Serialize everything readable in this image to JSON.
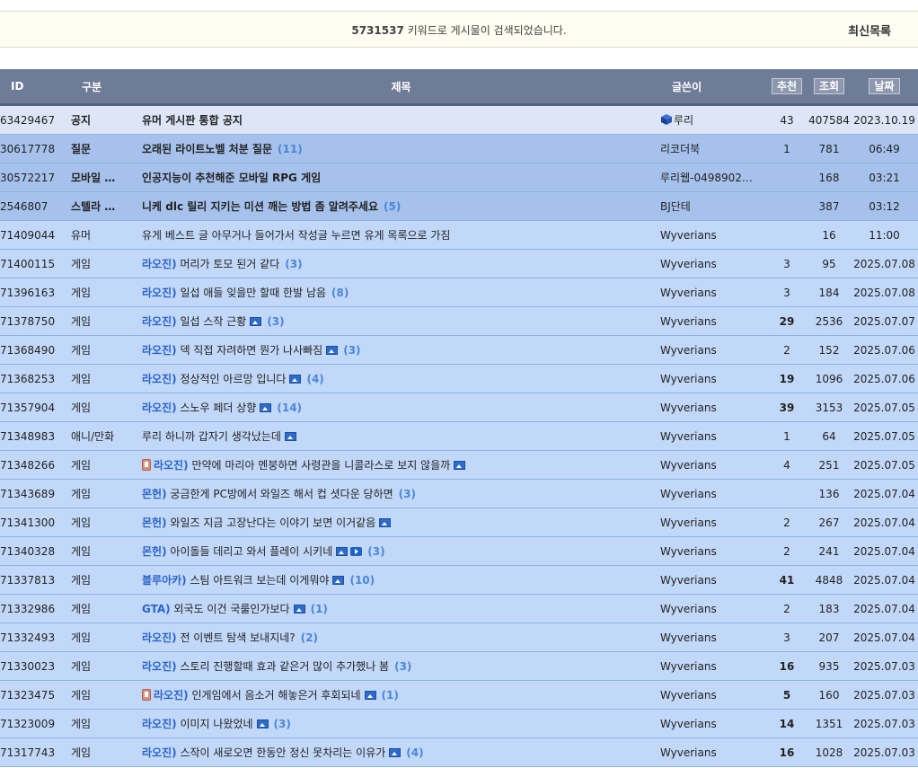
{
  "search": {
    "count": "5731537",
    "message": " 키워드로 게시물이 검색되었습니다.",
    "latest_label": "최신목록"
  },
  "table": {
    "headers": {
      "id": "ID",
      "category": "구분",
      "title": "제목",
      "author": "글쓴이",
      "recommend": "추천",
      "views": "조회",
      "date": "날짜"
    },
    "rows": [
      {
        "type": "notice",
        "id": "63429467",
        "category": "공지",
        "prefix": "",
        "title": "유머 게시판 통합 공지",
        "comments": "",
        "author": "루리",
        "author_icon": "cube-icon",
        "recommend": "43",
        "views": "407584",
        "date": "2023.10.19",
        "icons": []
      },
      {
        "type": "pinned",
        "id": "30617778",
        "category": "질문",
        "prefix": "",
        "title": "오래된 라이트노벨 처분 질문",
        "comments": "(11)",
        "author": "리코더북",
        "recommend": "1",
        "views": "781",
        "date": "06:49",
        "icons": []
      },
      {
        "type": "pinned",
        "id": "30572217",
        "category": "모바일 …",
        "prefix": "",
        "title": "인공지능이 추천해준 모바일 RPG 게임",
        "comments": "",
        "author": "루리웹-0498902…",
        "recommend": "",
        "views": "168",
        "date": "03:21",
        "icons": []
      },
      {
        "type": "pinned",
        "id": "2546807",
        "category": "스텔라 …",
        "prefix": "",
        "title": "니케 dlc 릴리 지키는 미션 깨는 방법 좀 알려주세요",
        "comments": "(5)",
        "author": "BJ단테",
        "recommend": "",
        "views": "387",
        "date": "03:12",
        "icons": []
      },
      {
        "type": "normal",
        "id": "71409044",
        "category": "유머",
        "prefix": "",
        "title": "유게 베스트 글 아무거나 들어가서 작성글 누르면 유게 목록으로 가짐",
        "comments": "",
        "author": "Wyverians",
        "recommend": "",
        "views": "16",
        "date": "11:00",
        "icons": []
      },
      {
        "type": "normal",
        "id": "71400115",
        "category": "게임",
        "prefix": "라오진)",
        "title": "머리가 토모 된거 같다",
        "comments": "(3)",
        "author": "Wyverians",
        "recommend": "3",
        "views": "95",
        "date": "2025.07.08",
        "icons": []
      },
      {
        "type": "normal",
        "id": "71396163",
        "category": "게임",
        "prefix": "라오진)",
        "title": "일섭 애들 잊을만 할때 한발 남음",
        "comments": "(8)",
        "author": "Wyverians",
        "recommend": "3",
        "views": "184",
        "date": "2025.07.08",
        "icons": []
      },
      {
        "type": "normal",
        "id": "71378750",
        "category": "게임",
        "prefix": "라오진)",
        "title": "일섭 스작 근황",
        "comments": "(3)",
        "author": "Wyverians",
        "recommend": "29",
        "rec_hot": true,
        "views": "2536",
        "date": "2025.07.07",
        "icons": [
          "image-icon"
        ]
      },
      {
        "type": "normal",
        "id": "71368490",
        "category": "게임",
        "prefix": "라오진)",
        "title": "덱 직접 자려하면 뭔가 나사빠짐",
        "comments": "(3)",
        "author": "Wyverians",
        "recommend": "2",
        "views": "152",
        "date": "2025.07.06",
        "icons": [
          "image-icon"
        ]
      },
      {
        "type": "normal",
        "id": "71368253",
        "category": "게임",
        "prefix": "라오진)",
        "title": "정상적인 아르망 입니다",
        "comments": "(4)",
        "author": "Wyverians",
        "recommend": "19",
        "rec_hot": true,
        "views": "1096",
        "date": "2025.07.06",
        "icons": [
          "image-icon"
        ]
      },
      {
        "type": "normal",
        "id": "71357904",
        "category": "게임",
        "prefix": "라오진)",
        "title": "스노우 페더 상향",
        "comments": "(14)",
        "author": "Wyverians",
        "recommend": "39",
        "rec_hot": true,
        "views": "3153",
        "date": "2025.07.05",
        "icons": [
          "image-icon"
        ]
      },
      {
        "type": "normal",
        "id": "71348983",
        "category": "애니/만화",
        "prefix": "",
        "title": "루리 하니까 갑자기 생각났는데",
        "comments": "",
        "author": "Wyverians",
        "recommend": "1",
        "views": "64",
        "date": "2025.07.05",
        "icons": [
          "image-icon"
        ]
      },
      {
        "type": "normal",
        "id": "71348266",
        "category": "게임",
        "prefix": "라오진)",
        "title": "만약에 마리아 멘붕하면 사령관을 니콜라스로 보지 않을까",
        "comments": "",
        "author": "Wyverians",
        "recommend": "4",
        "views": "251",
        "date": "2025.07.05",
        "icons": [
          "image-icon"
        ],
        "mobile": true
      },
      {
        "type": "normal",
        "id": "71343689",
        "category": "게임",
        "prefix": "몬헌)",
        "title": "궁금한게 PC방에서 와일즈 해서 컵 셧다운 당하면",
        "comments": "(3)",
        "author": "Wyverians",
        "recommend": "",
        "views": "136",
        "date": "2025.07.04",
        "icons": []
      },
      {
        "type": "normal",
        "id": "71341300",
        "category": "게임",
        "prefix": "몬헌)",
        "title": "와일즈 지금 고장난다는 이야기 보면 이거같음",
        "comments": "",
        "author": "Wyverians",
        "recommend": "2",
        "views": "267",
        "date": "2025.07.04",
        "icons": [
          "image-icon"
        ]
      },
      {
        "type": "normal",
        "id": "71340328",
        "category": "게임",
        "prefix": "몬헌)",
        "title": "아이돌들 데리고 와서 플레이 시키네",
        "comments": "(3)",
        "author": "Wyverians",
        "recommend": "2",
        "views": "241",
        "date": "2025.07.04",
        "icons": [
          "image-icon",
          "video-icon"
        ]
      },
      {
        "type": "normal",
        "id": "71337813",
        "category": "게임",
        "prefix": "블루아카)",
        "title": "스팀 아트워크 보는데 이게뭐야",
        "comments": "(10)",
        "author": "Wyverians",
        "recommend": "41",
        "rec_hot": true,
        "views": "4848",
        "date": "2025.07.04",
        "icons": [
          "image-icon"
        ]
      },
      {
        "type": "normal",
        "id": "71332986",
        "category": "게임",
        "prefix": "GTA)",
        "title": "외국도 이건 국룰인가보다",
        "comments": "(1)",
        "author": "Wyverians",
        "recommend": "2",
        "views": "183",
        "date": "2025.07.04",
        "icons": [
          "image-icon"
        ]
      },
      {
        "type": "normal",
        "id": "71332493",
        "category": "게임",
        "prefix": "라오진)",
        "title": "전 이벤트 탐색 보내지네?",
        "comments": "(2)",
        "author": "Wyverians",
        "recommend": "3",
        "views": "207",
        "date": "2025.07.04",
        "icons": []
      },
      {
        "type": "normal",
        "id": "71330023",
        "category": "게임",
        "prefix": "라오진)",
        "title": "스토리 진행할때 효과 같은거 많이 추가했나 봄",
        "comments": "(3)",
        "author": "Wyverians",
        "recommend": "16",
        "rec_hot": true,
        "views": "935",
        "date": "2025.07.03",
        "icons": []
      },
      {
        "type": "normal",
        "id": "71323475",
        "category": "게임",
        "prefix": "라오진)",
        "title": "인게임에서 음소거 해놓은거 후회되네",
        "comments": "(1)",
        "author": "Wyverians",
        "recommend": "5",
        "rec_hot": true,
        "views": "160",
        "date": "2025.07.03",
        "icons": [
          "image-icon"
        ],
        "mobile": true
      },
      {
        "type": "normal",
        "id": "71323009",
        "category": "게임",
        "prefix": "라오진)",
        "title": "이미지 나왔었네",
        "comments": "(3)",
        "author": "Wyverians",
        "recommend": "14",
        "rec_hot": true,
        "views": "1351",
        "date": "2025.07.03",
        "icons": [
          "image-icon"
        ]
      },
      {
        "type": "normal",
        "id": "71317743",
        "category": "게임",
        "prefix": "라오진)",
        "title": "스작이 새로오면 한동안 정신 못차리는 이유가",
        "comments": "(4)",
        "author": "Wyverians",
        "recommend": "16",
        "rec_hot": true,
        "views": "1028",
        "date": "2025.07.03",
        "icons": [
          "image-icon"
        ]
      }
    ]
  }
}
